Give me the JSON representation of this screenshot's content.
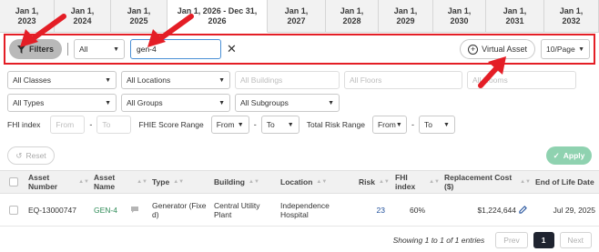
{
  "year_tabs": [
    {
      "label": "Jan 1,\n2023",
      "active": false
    },
    {
      "label": "Jan 1,\n2024",
      "active": false
    },
    {
      "label": "Jan 1,\n2025",
      "active": false
    },
    {
      "label": "Jan 1, 2026 - Dec 31,\n2026",
      "active": true
    },
    {
      "label": "Jan 1,\n2027",
      "active": false
    },
    {
      "label": "Jan 1,\n2028",
      "active": false
    },
    {
      "label": "Jan 1,\n2029",
      "active": false
    },
    {
      "label": "Jan 1,\n2030",
      "active": false
    },
    {
      "label": "Jan 1,\n2031",
      "active": false
    },
    {
      "label": "Jan 1,\n2032",
      "active": false
    }
  ],
  "toolbar": {
    "filters_label": "Filters",
    "scope_value": "All",
    "search_value": "gen-4",
    "virtual_asset_label": "Virtual Asset",
    "page_size_value": "10/Page"
  },
  "filters": {
    "classes": "All Classes",
    "locations": "All Locations",
    "buildings": "All Buildings",
    "floors": "All Floors",
    "rooms": "All Rooms",
    "types": "All Types",
    "groups": "All Groups",
    "subgroups": "All Subgroups",
    "fhi_index_label": "FHI index",
    "fhi_from_placeholder": "From",
    "fhi_to_placeholder": "To",
    "fhie_label": "FHIE Score Range",
    "fhie_from": "From",
    "fhie_to": "To",
    "risk_label": "Total Risk Range",
    "risk_from": "From",
    "risk_to": "To",
    "reset_label": "Reset",
    "apply_label": "Apply"
  },
  "table": {
    "headers": [
      "Asset Number",
      "Asset Name",
      "Type",
      "Building",
      "Location",
      "Risk",
      "FHI index",
      "Replacement Cost ($)",
      "End of Life Date"
    ],
    "rows": [
      {
        "asset_number": "EQ-13000747",
        "asset_name": "GEN-4",
        "type": "Generator (Fixe\nd)",
        "building": "Central Utility\nPlant",
        "location": "Independence\nHospital",
        "risk": "23",
        "fhi_index": "60%",
        "replacement_cost": "$1,224,644",
        "end_of_life": "Jul 29, 2025"
      }
    ]
  },
  "pagination": {
    "showing_text": "Showing 1 to 1 of 1 entries",
    "prev_label": "Prev",
    "current_page": "1",
    "next_label": "Next"
  },
  "colors": {
    "annotation_red": "#e41e26",
    "apply_green": "#8fd2b0",
    "link_green": "#2e8b57"
  }
}
